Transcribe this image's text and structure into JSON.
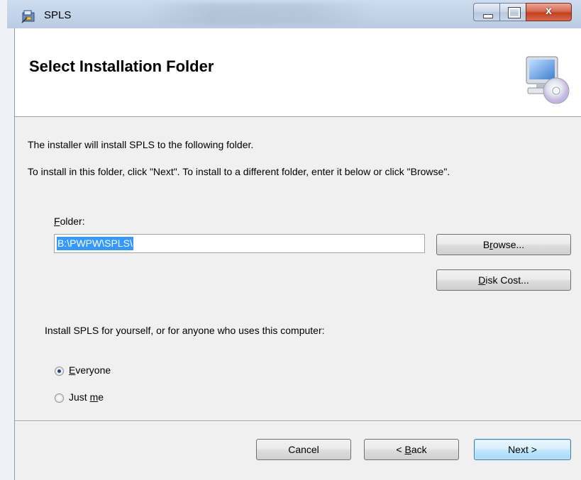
{
  "window": {
    "title": "SPLS",
    "close_glyph": "x"
  },
  "header": {
    "title": "Select Installation Folder",
    "icon": "computer-cd-icon"
  },
  "body": {
    "line1": "The installer will install SPLS to the following folder.",
    "line2": "To install in this folder, click \"Next\". To install to a different folder, enter it below or click \"Browse\"."
  },
  "folder": {
    "label_accel": "F",
    "label_rest": "older:",
    "value": "B:\\PWPW\\SPLS\\"
  },
  "buttons": {
    "browse": {
      "pre": "B",
      "accel": "r",
      "post": "owse..."
    },
    "disk_cost": {
      "accel": "D",
      "post": "isk Cost..."
    },
    "cancel": "Cancel",
    "back": {
      "pre": "< ",
      "accel": "B",
      "post": "ack"
    },
    "next": "Next >"
  },
  "install_for": {
    "prompt": "Install SPLS for yourself, or for anyone who uses this computer:",
    "options": [
      {
        "accel": "E",
        "rest": "veryone",
        "selected": true
      },
      {
        "pre": "Just ",
        "accel": "m",
        "rest": "e",
        "selected": false
      }
    ]
  },
  "colors": {
    "selection": "#3399ff",
    "default_button_border": "#3c7fb1"
  }
}
